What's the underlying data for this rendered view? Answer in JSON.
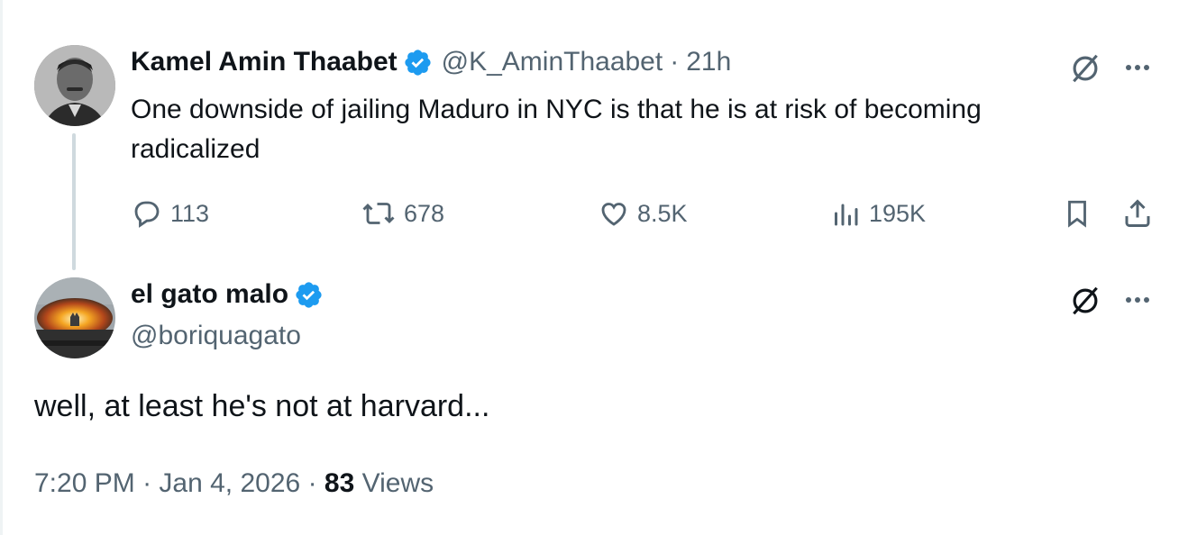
{
  "quoted_tweet": {
    "display_name": "Kamel Amin Thaabet",
    "handle": "@K_AminThaabet",
    "separator": "·",
    "time": "21h",
    "text": "One downside of jailing Maduro in NYC is that he is at risk of becoming radicalized",
    "stats": {
      "replies": "113",
      "reposts": "678",
      "likes": "8.5K",
      "views": "195K"
    }
  },
  "reply_tweet": {
    "display_name": "el gato malo",
    "handle": "@boriquagato",
    "text": "well, at least he's not at harvard...",
    "time": "7:20 PM",
    "date": "Jan 4, 2026",
    "views_count": "83",
    "views_label": "Views",
    "separator": "·"
  },
  "colors": {
    "text_primary": "#0f1419",
    "text_secondary": "#536471",
    "verified_blue": "#1d9bf0",
    "thread_line": "#cfd9de"
  },
  "icons": {
    "grok": "grok-slash-circle-icon",
    "more": "more-dots-icon",
    "reply": "reply-bubble-icon",
    "repost": "repost-arrows-icon",
    "like": "heart-icon",
    "views": "analytics-bars-icon",
    "bookmark": "bookmark-icon",
    "share": "share-upload-icon",
    "verified": "verified-badge-icon"
  }
}
